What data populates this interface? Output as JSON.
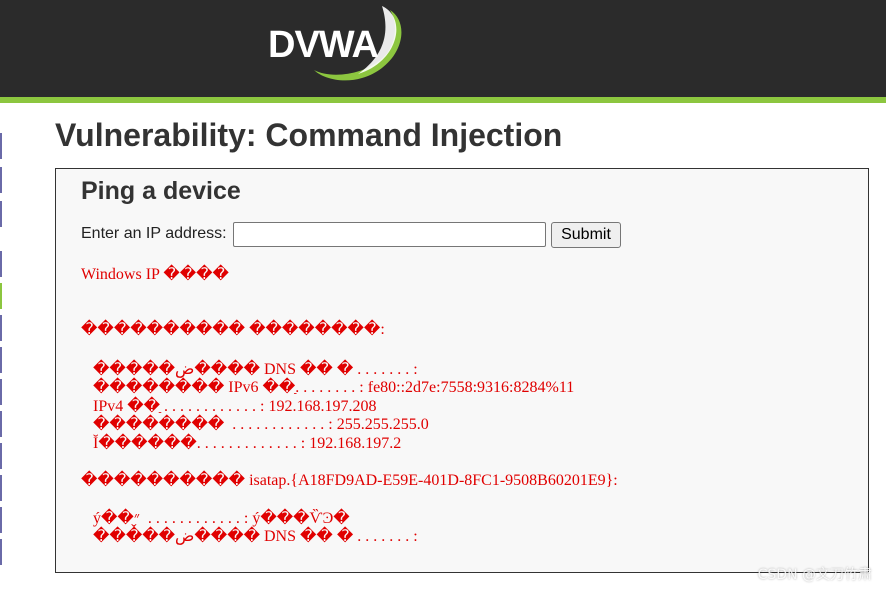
{
  "header": {
    "logo_text": "DVWA"
  },
  "page": {
    "title": "Vulnerability: Command Injection"
  },
  "panel": {
    "heading": "Ping a device",
    "ip_label": "Enter an IP address:",
    "ip_value": "",
    "submit_label": "Submit"
  },
  "output": {
    "lines": [
      "Windows IP ����",
      "���������� ��������:",
      "   �����ض���� DNS �� � . . . . . . . :",
      "   �������� IPv6 ��ַ. . . . . . . . : fe80::2d7e:7558:9316:8284%11",
      "   IPv4 ��ַ . . . . . . . . . . . . : 192.168.197.208",
      "   ��������  . . . . . . . . . . . . : 255.255.255.0",
      "   Ĭ������. . . . . . . . . . . . . : 192.168.197.2",
      "���������� isatap.{A18FD9AD-E59E-401D-8FC1-9508B60201E9}:",
      "   ý��״̬  . . . . . . . . . . . . : ý���ѶϿ�",
      "   �����ض���� DNS �� � . . . . . . . :"
    ]
  },
  "watermark": {
    "text": "CSDN @文刀竹肃"
  },
  "colors": {
    "header_bg": "#2b2b2b",
    "accent_green": "#8cc63f",
    "output_red": "#e00000"
  }
}
